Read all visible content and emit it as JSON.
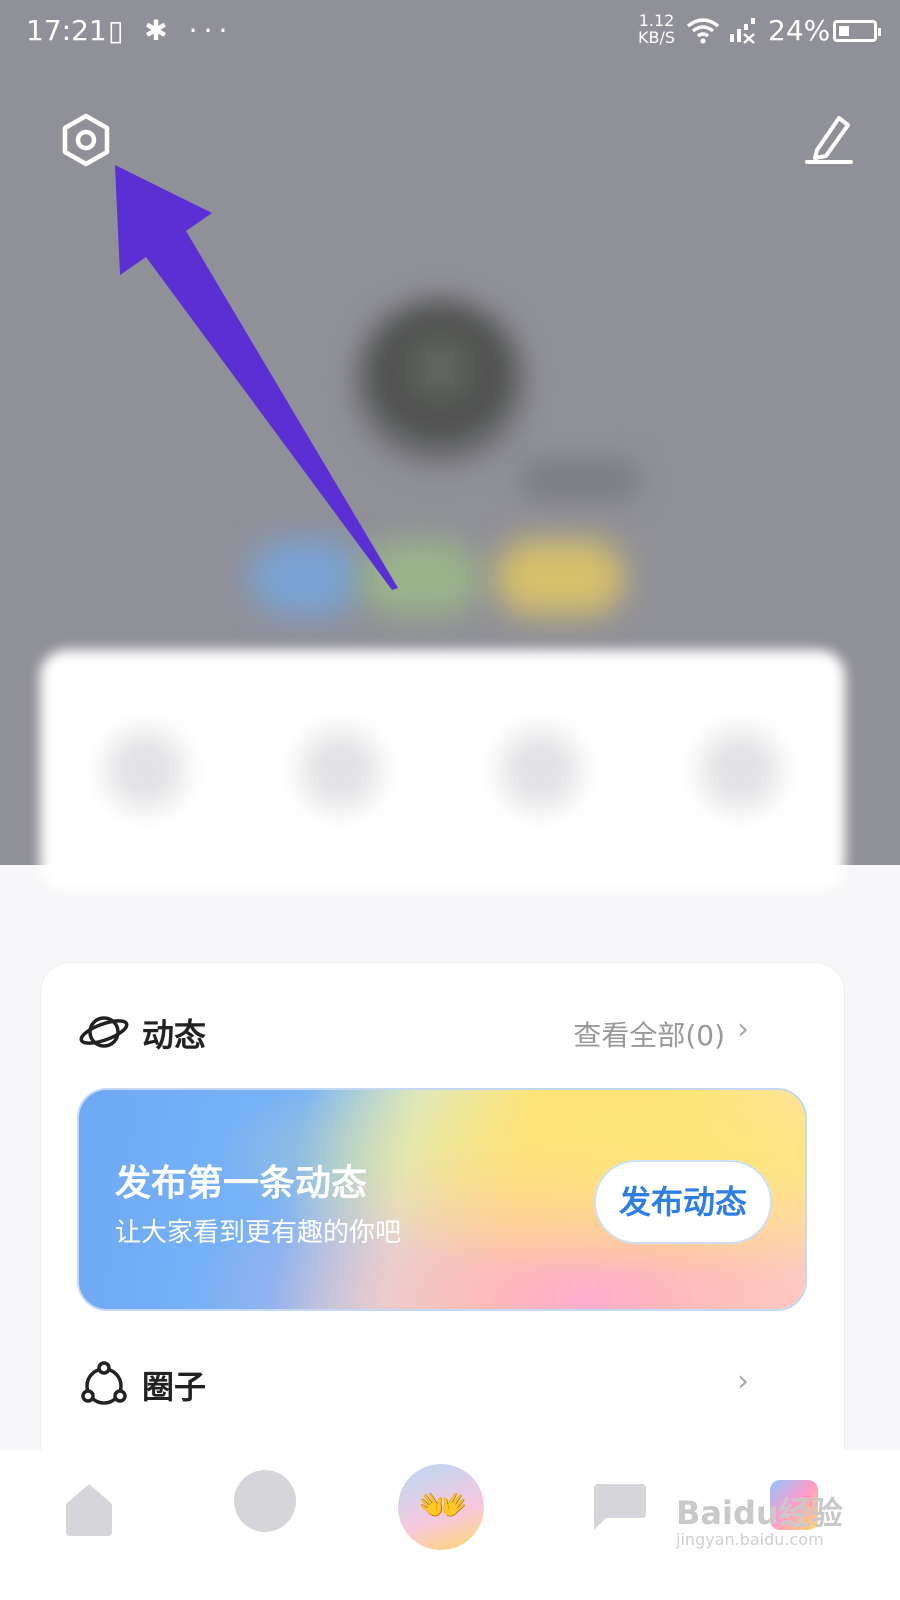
{
  "status_bar": {
    "time": "17:21",
    "left_icons": "▯ ✱ ···",
    "speed_value": "1.12",
    "speed_unit": "KB/S",
    "battery": "24%"
  },
  "header": {
    "settings_icon": "hexagon-gear-icon",
    "edit_icon": "pencil-icon"
  },
  "dynamics": {
    "title": "动态",
    "view_all": "查看全部(0)",
    "chevron": "›"
  },
  "promo": {
    "title": "发布第一条动态",
    "subtitle": "让大家看到更有趣的你吧",
    "button": "发布动态"
  },
  "circles": {
    "title": "圈子",
    "chevron": "›"
  },
  "tabbar": {
    "center_emoji": "👐"
  },
  "watermark": {
    "text": "Baidu经验",
    "sub": "jingyan.baidu.com"
  },
  "colors": {
    "arrow": "#5a2fd3",
    "header_bg": "#909098",
    "accent_blue": "#2e7ee6"
  }
}
